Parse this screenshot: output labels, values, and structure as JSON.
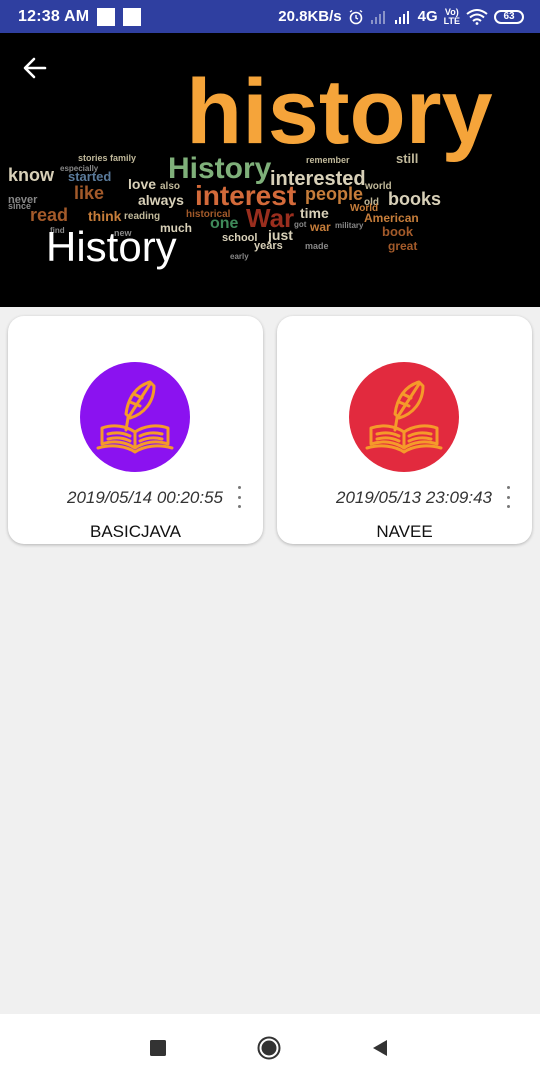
{
  "status_bar": {
    "time": "12:38 AM",
    "net_speed": "20.8KB/s",
    "network": "4G",
    "volte_top": "Vo)",
    "volte_bottom": "LTE",
    "battery": "63"
  },
  "header": {
    "title": "History",
    "background_image": "history word-cloud image",
    "back_icon": "arrow-left-icon"
  },
  "items": [
    {
      "date": "2019/05/14 00:20:55",
      "name": "BASICJAVA",
      "color": "#8b12f0",
      "icon": "quill-book-icon"
    },
    {
      "date": "2019/05/13 23:09:43",
      "name": "NAVEE",
      "color": "#e22a3e",
      "icon": "quill-book-icon"
    }
  ],
  "nav_bar": {
    "recents_icon": "square-icon",
    "home_icon": "circle-icon",
    "back_icon": "triangle-back-icon"
  },
  "colors": {
    "status_bar": "#2f3fa0",
    "accent_orange": "#f5a43a",
    "icon_line": "#f59a2a"
  }
}
